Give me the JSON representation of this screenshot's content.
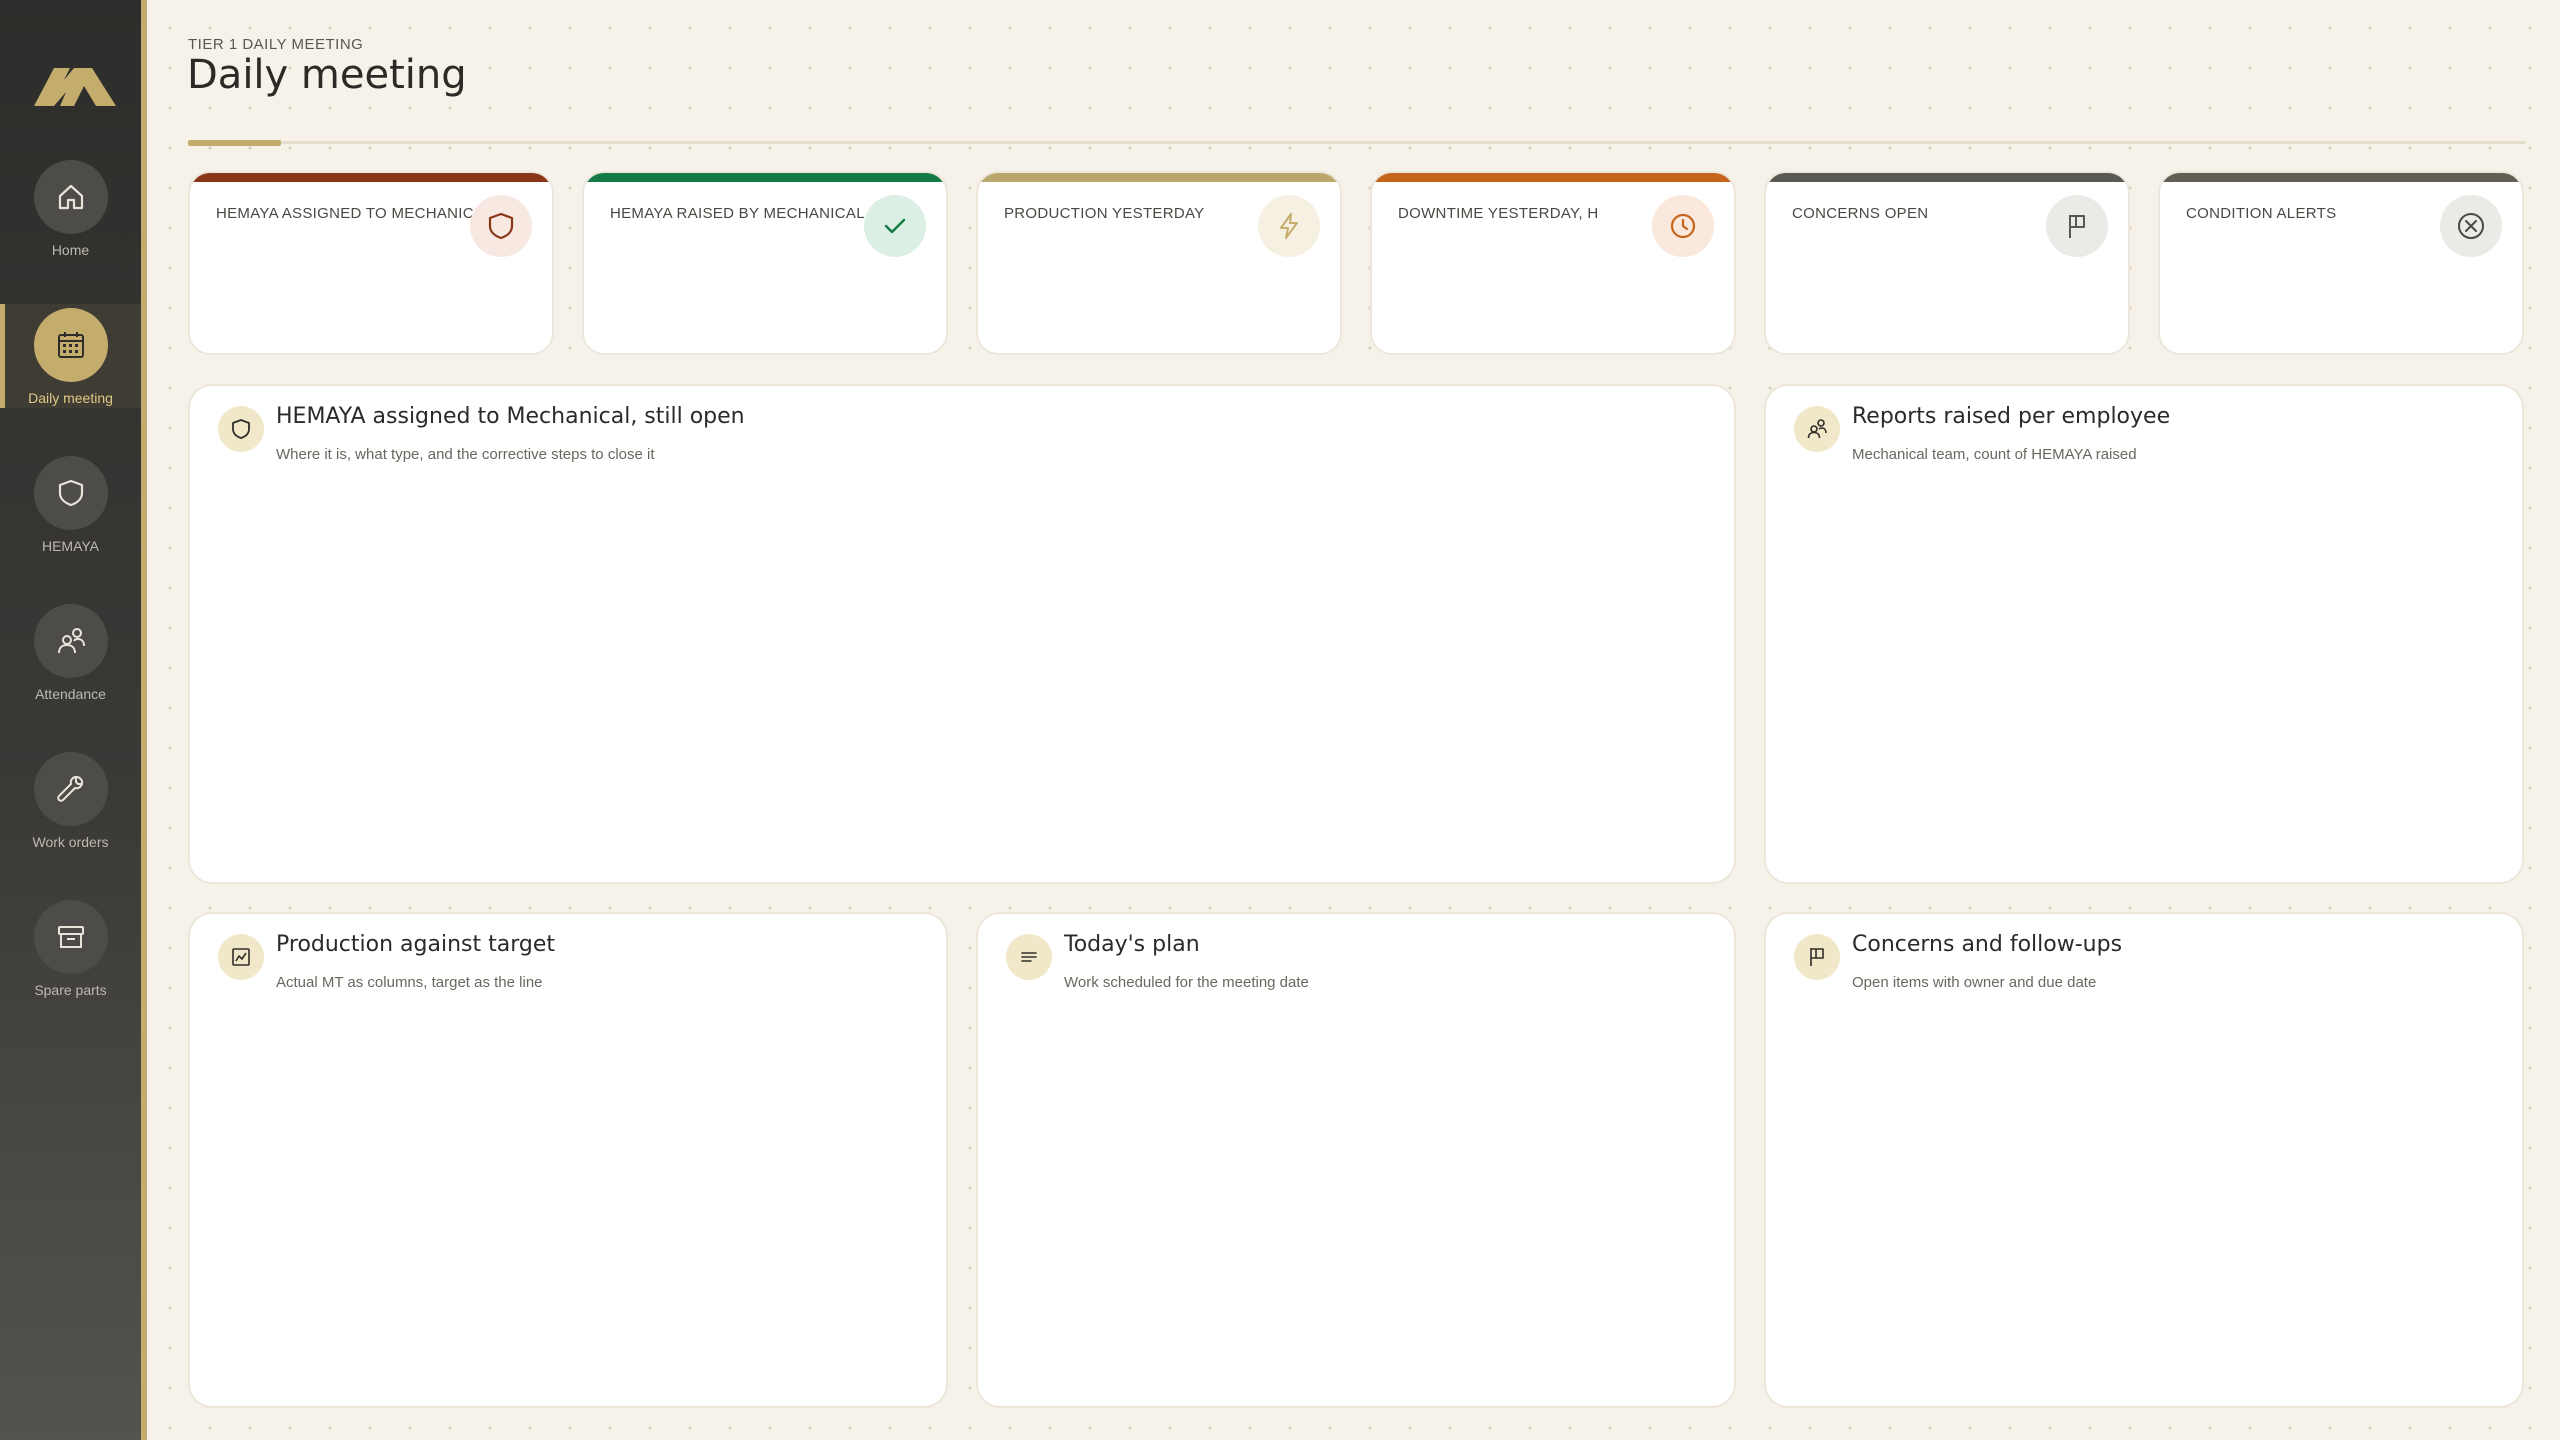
{
  "nav": {
    "items": [
      {
        "label": "Home",
        "icon": "home-icon"
      },
      {
        "label": "Daily meeting",
        "icon": "calendar-icon",
        "active": true
      },
      {
        "label": "HEMAYA",
        "icon": "shield-icon"
      },
      {
        "label": "Attendance",
        "icon": "people-icon"
      },
      {
        "label": "Work orders",
        "icon": "wrench-icon"
      },
      {
        "label": "Spare parts",
        "icon": "box-icon"
      }
    ]
  },
  "header": {
    "eyebrow": "TIER 1 DAILY MEETING",
    "title": "Daily meeting"
  },
  "kpis": [
    {
      "label": "HEMAYA ASSIGNED TO MECHANICAL",
      "icon": "shield-icon",
      "accent": "#8a3418"
    },
    {
      "label": "HEMAYA RAISED BY MECHANICAL",
      "icon": "check-icon",
      "accent": "#147a45"
    },
    {
      "label": "PRODUCTION YESTERDAY",
      "icon": "bolt-icon",
      "accent": "#b9a76b"
    },
    {
      "label": "DOWNTIME YESTERDAY, H",
      "icon": "clock-icon",
      "accent": "#c7641c"
    },
    {
      "label": "CONCERNS OPEN",
      "icon": "flag-icon",
      "accent": "#5a5853"
    },
    {
      "label": "CONDITION ALERTS",
      "icon": "x-circle-icon",
      "accent": "#625f55"
    }
  ],
  "panels": {
    "hemaya_open": {
      "title": "HEMAYA assigned to Mechanical, still open",
      "subtitle": "Where it is, what type, and the corrective steps to close it",
      "icon": "shield-icon"
    },
    "reports_per_employee": {
      "title": "Reports raised per employee",
      "subtitle": "Mechanical team, count of HEMAYA raised",
      "icon": "people-icon"
    },
    "production_target": {
      "title": "Production against target",
      "subtitle": "Actual MT as columns, target as the line",
      "icon": "chart-icon"
    },
    "todays_plan": {
      "title": "Today's plan",
      "subtitle": "Work scheduled for the meeting date",
      "icon": "lines-icon"
    },
    "concerns": {
      "title": "Concerns and follow-ups",
      "subtitle": "Open items with owner and due date",
      "icon": "flag-icon"
    }
  },
  "colors": {
    "gold": "#c4ad6c",
    "background": "#f6f2e9"
  }
}
